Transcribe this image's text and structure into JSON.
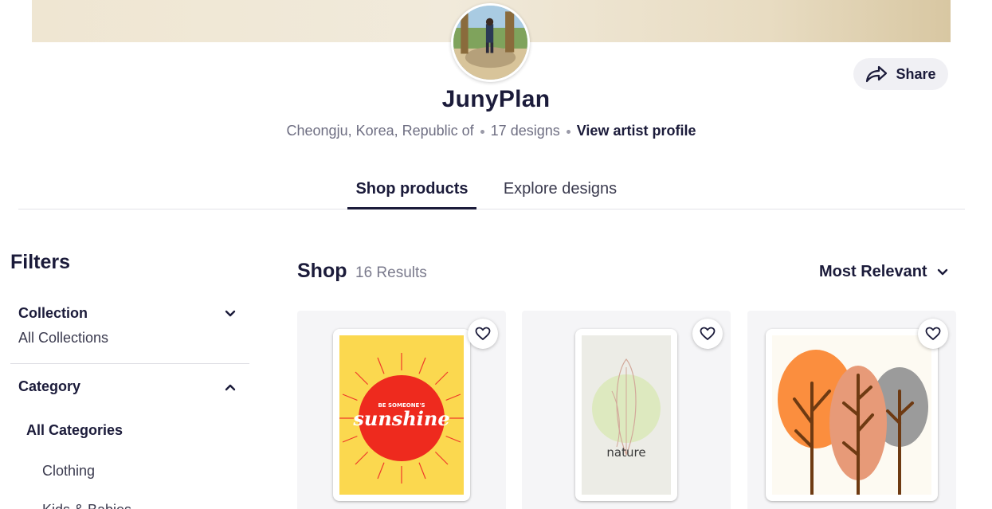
{
  "artist": {
    "name": "JunyPlan",
    "location": "Cheongju, Korea, Republic of",
    "designs_count": "17 designs",
    "profile_link": "View artist profile"
  },
  "share": {
    "label": "Share"
  },
  "tabs": [
    {
      "label": "Shop products",
      "active": true
    },
    {
      "label": "Explore designs",
      "active": false
    }
  ],
  "filters": {
    "title": "Filters",
    "collection": {
      "title": "Collection",
      "value": "All Collections",
      "expanded": false
    },
    "category": {
      "title": "Category",
      "expanded": true,
      "items": [
        "All Categories",
        "Clothing",
        "Kids & Babies"
      ]
    }
  },
  "shop": {
    "title": "Shop",
    "results": "16 Results",
    "sort_label": "Most Relevant"
  },
  "products": [
    {
      "art_small_text": "BE SOMEONE'S",
      "art_main_text": "sunshine",
      "icon": "heart-icon"
    },
    {
      "art_main_text": "nature",
      "icon": "heart-icon"
    },
    {
      "icon": "heart-icon"
    }
  ],
  "colors": {
    "primary_text": "#1b1b3a",
    "muted_text": "#6e6e82",
    "card_bg": "#f5f5f7",
    "share_bg": "#f0f0f4"
  }
}
